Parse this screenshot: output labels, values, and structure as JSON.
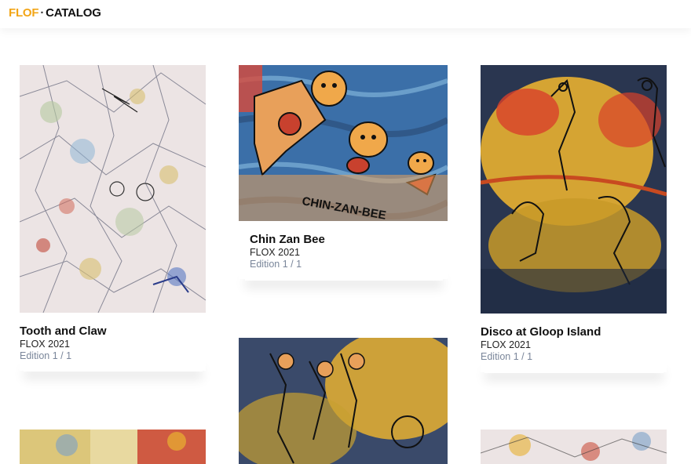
{
  "header": {
    "brand_name": "FLOF",
    "separator": "·",
    "section": "CATALOG"
  },
  "cards": [
    {
      "title": "Tooth and Claw",
      "artist": "FLOX 2021",
      "edition": "Edition 1 / 1"
    },
    {
      "title": "Chin Zan Bee",
      "artist": "FLOX 2021",
      "edition": "Edition 1 / 1",
      "art_text": "CHIN-ZAN-BEE"
    },
    {
      "title": "Disco at Gloop Island",
      "artist": "FLOX 2021",
      "edition": "Edition 1 / 1"
    }
  ],
  "colors": {
    "brand_accent": "#f2a516",
    "edition_text": "#7a869a"
  }
}
